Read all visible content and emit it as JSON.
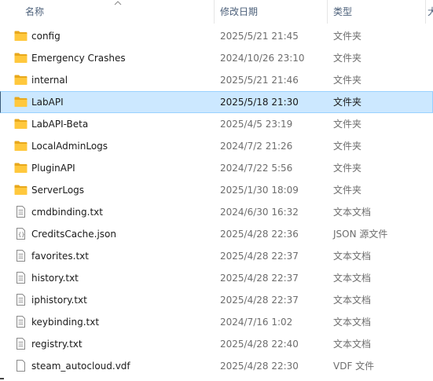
{
  "header": {
    "name_label": "名称",
    "date_label": "修改日期",
    "type_label": "类型",
    "size_label": "大"
  },
  "files": [
    {
      "name": "config",
      "date": "2025/5/21 21:45",
      "type": "文件夹",
      "icon": "folder-icon",
      "selected": false
    },
    {
      "name": "Emergency Crashes",
      "date": "2024/10/26 23:10",
      "type": "文件夹",
      "icon": "folder-icon",
      "selected": false
    },
    {
      "name": "internal",
      "date": "2025/5/21 21:46",
      "type": "文件夹",
      "icon": "folder-icon",
      "selected": false
    },
    {
      "name": "LabAPI",
      "date": "2025/5/18 21:30",
      "type": "文件夹",
      "icon": "folder-icon",
      "selected": true
    },
    {
      "name": "LabAPI-Beta",
      "date": "2025/4/5 23:19",
      "type": "文件夹",
      "icon": "folder-icon",
      "selected": false
    },
    {
      "name": "LocalAdminLogs",
      "date": "2024/7/2 21:26",
      "type": "文件夹",
      "icon": "folder-icon",
      "selected": false
    },
    {
      "name": "PluginAPI",
      "date": "2024/7/22 5:56",
      "type": "文件夹",
      "icon": "folder-icon",
      "selected": false
    },
    {
      "name": "ServerLogs",
      "date": "2025/1/30 18:09",
      "type": "文件夹",
      "icon": "folder-icon",
      "selected": false
    },
    {
      "name": "cmdbinding.txt",
      "date": "2024/6/30 16:32",
      "type": "文本文档",
      "icon": "text-file-icon",
      "selected": false
    },
    {
      "name": "CreditsCache.json",
      "date": "2025/4/28 22:36",
      "type": "JSON 源文件",
      "icon": "json-file-icon",
      "selected": false
    },
    {
      "name": "favorites.txt",
      "date": "2025/4/28 22:37",
      "type": "文本文档",
      "icon": "text-file-icon",
      "selected": false
    },
    {
      "name": "history.txt",
      "date": "2025/4/28 22:37",
      "type": "文本文档",
      "icon": "text-file-icon",
      "selected": false
    },
    {
      "name": "iphistory.txt",
      "date": "2025/4/28 22:37",
      "type": "文本文档",
      "icon": "text-file-icon",
      "selected": false
    },
    {
      "name": "keybinding.txt",
      "date": "2024/7/16 1:02",
      "type": "文本文档",
      "icon": "text-file-icon",
      "selected": false
    },
    {
      "name": "registry.txt",
      "date": "2025/4/28 22:40",
      "type": "文本文档",
      "icon": "text-file-icon",
      "selected": false
    },
    {
      "name": "steam_autocloud.vdf",
      "date": "2025/4/28 22:30",
      "type": "VDF 文件",
      "icon": "generic-file-icon",
      "selected": false
    }
  ],
  "colors": {
    "selection_bg": "#cce8ff",
    "selection_border": "#99d1ff",
    "folder_yellow": "#ffc83d",
    "header_text": "#4c607a",
    "meta_text": "#6d6d6d"
  }
}
